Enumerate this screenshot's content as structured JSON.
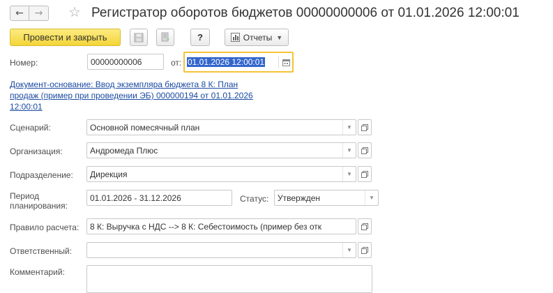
{
  "window": {
    "title": "Регистратор оборотов бюджетов 00000000006 от 01.01.2026 12:00:01",
    "back_icon": "←",
    "forward_icon": "→",
    "star_icon": "☆"
  },
  "toolbar": {
    "post_close_label": "Провести и закрыть",
    "help_label": "?",
    "reports_label": "Отчеты"
  },
  "form": {
    "number": {
      "label": "Номер:",
      "value": "00000000006"
    },
    "date": {
      "label": "от:",
      "value": "01.01.2026 12:00:01"
    },
    "base_document": {
      "lines": [
        "Документ-основание: Ввод экземпляра бюджета 8 К: План",
        "продаж (пример при проведении ЭБ) 000000194 от 01.01.2026",
        "12:00:01"
      ]
    },
    "scenario": {
      "label": "Сценарий:",
      "value": "Основной помесячный план"
    },
    "organization": {
      "label": "Организация:",
      "value": "Андромеда Плюс"
    },
    "department": {
      "label": "Подразделение:",
      "value": "Дирекция"
    },
    "period": {
      "label_lines": [
        "Период",
        "планирования:"
      ],
      "value": "01.01.2026 - 31.12.2026"
    },
    "status": {
      "label": "Статус:",
      "value": "Утвержден"
    },
    "rule": {
      "label": "Правило расчета:",
      "value": "8 К: Выручка с НДС --> 8 К: Себестоимость (пример без отк"
    },
    "responsible": {
      "label": "Ответственный:",
      "value": ""
    },
    "comment": {
      "label": "Комментарий:",
      "value": ""
    }
  },
  "colors": {
    "primary_button": "#f3d537",
    "focus_border": "#f5c338",
    "link": "#1a4aa3",
    "selection": "#3366cc"
  }
}
